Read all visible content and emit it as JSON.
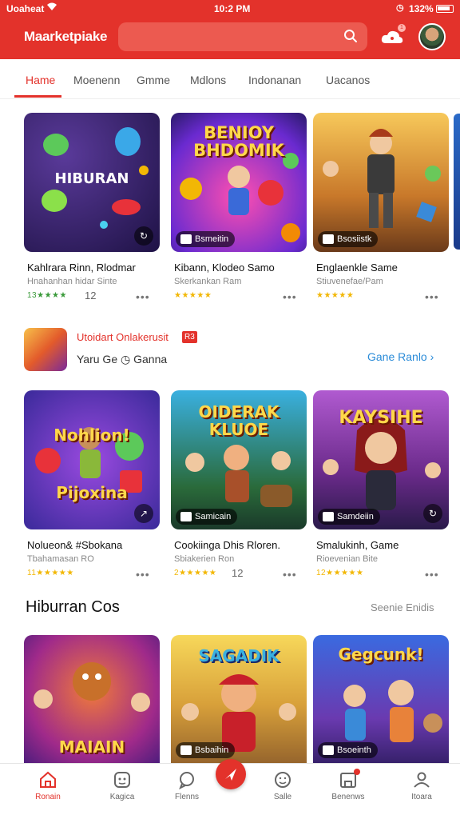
{
  "status_bar": {
    "carrier": "Uoaheat",
    "time": "10:2 PM",
    "battery": "132%"
  },
  "header": {
    "brand": "Maarketpiake",
    "search_placeholder": "",
    "notification_count": "1"
  },
  "tabs": [
    "Hame",
    "Moenenn",
    "Gmme",
    "Mdlons",
    "Indonanan",
    "Uacanos"
  ],
  "row1": [
    {
      "thumb_title": "HIBURAN",
      "tag": "",
      "title": "Kahlrara Rinn, Rlodmar",
      "subtitle": "Hnahanhan hidar Sinte",
      "rating_label": "13",
      "stars": "★★★★",
      "num": "12"
    },
    {
      "thumb_title": "BENIOY\nBHDOMIK",
      "tag": "Bsmeitin",
      "title": "Kibann, Klodeo Samo",
      "subtitle": "Skerkankan Ram",
      "rating_label": "",
      "stars": "★★★★★",
      "num": ""
    },
    {
      "thumb_title": "",
      "tag": "Bsosiistk",
      "title": "Englaenkle Same",
      "subtitle": "Stiuvenefae/Pam",
      "rating_label": "",
      "stars": "★★★★★",
      "num": ""
    }
  ],
  "promo": {
    "label": "Utoidart Onlakerusit",
    "badge": "R3",
    "subtitle": "Yaru Ge",
    "subtitle2": "Ganna",
    "link": "Gane Ranlo ›"
  },
  "row2": [
    {
      "thumb_title": "Nohlion!\nPijoxina",
      "tag": "",
      "title": "Nolueon& #Sbokana",
      "subtitle": "Tbahamasan RO",
      "rating_label": "11",
      "stars": "★★★★★",
      "num": ""
    },
    {
      "thumb_title": "OIDERAK\nKLUOE",
      "tag": "Samicain",
      "title": "Cookiinga Dhis Rloren.",
      "subtitle": "Sbiakerien Ron",
      "rating_label": "2",
      "stars": "★★★★★",
      "num": "12"
    },
    {
      "thumb_title": "KAYSIHE",
      "tag": "Samdeiin",
      "title": "Smalukinh, Game",
      "subtitle": "Rioevenian Bite",
      "rating_label": "12",
      "stars": "★★★★★",
      "num": ""
    }
  ],
  "section3": {
    "title": "Hiburran Cos",
    "link": "Seenie Enidis"
  },
  "row3": [
    {
      "thumb_title": "MAIAIN",
      "tag": ""
    },
    {
      "thumb_title": "SAGADIK",
      "tag": "Bsbaihin"
    },
    {
      "thumb_title": "Gegcunk!",
      "tag": "Bsoeinth"
    }
  ],
  "nav": [
    {
      "label": "Ronain",
      "icon": "home-icon"
    },
    {
      "label": "Kagica",
      "icon": "game-icon"
    },
    {
      "label": "Flenns",
      "icon": "chat-icon"
    },
    {
      "label": "",
      "icon": "send-icon"
    },
    {
      "label": "Salle",
      "icon": "smile-icon"
    },
    {
      "label": "Benenws",
      "icon": "gift-icon"
    },
    {
      "label": "Itoara",
      "icon": "user-icon"
    }
  ],
  "colors": {
    "accent": "#e3322b",
    "link": "#2a8bd8",
    "star": "#f2b705"
  }
}
